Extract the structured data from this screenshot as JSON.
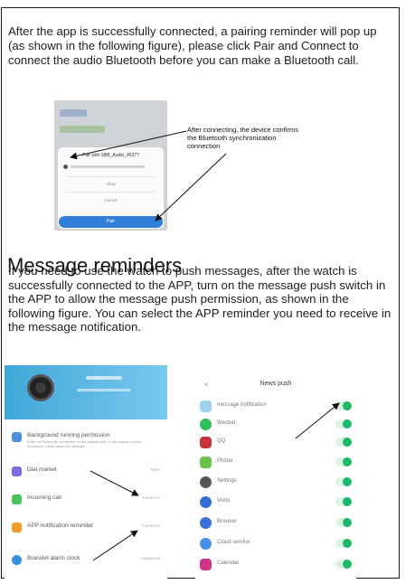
{
  "intro": {
    "text": "After the app is successfully connected, a pairing reminder will pop up (as shown in the following figure), please click Pair and Connect to connect the audio Bluetooth before you can make a Bluetooth call."
  },
  "pairing_dialog": {
    "title": "Pair with SBB_Audio_4637?",
    "option_1": "Allow",
    "option_2": "Cancel",
    "button": "Pair",
    "annotation": "After connecting, the device confirms the Bluetooth synchronization connection"
  },
  "section": {
    "heading": "Message reminders",
    "text": "If you need to use the watch to push messages, after the watch is successfully connected to the APP, turn on the message push switch in the APP to allow the message push permission, as shown in the following figure. You can select the APP reminder you need to receive in the message notification."
  },
  "app_left": {
    "rows": [
      {
        "label": "Background running permission",
        "sub": "Keep the Bluetooth connection in the background; in permission ensure reminders. Learn about the settings",
        "value": "",
        "color": "#4a90d9"
      },
      {
        "label": "Dial market",
        "sub": "",
        "value": "More",
        "color": "#7b6ae0"
      },
      {
        "label": "Incoming call",
        "sub": "",
        "value": "Turned on",
        "color": "#4cc25a"
      },
      {
        "label": "APP notification reminder",
        "sub": "",
        "value": "Turned on",
        "color": "#f09a2c"
      },
      {
        "label": "Bracelet alarm clock",
        "sub": "",
        "value": "Unopened",
        "color": "#3a8ee0"
      }
    ]
  },
  "app_right": {
    "back": "<",
    "title": "News push",
    "rows": [
      {
        "label": "message notification",
        "color": "#9fd0f0"
      },
      {
        "label": "Wechat",
        "color": "#2fbf5a"
      },
      {
        "label": "QQ",
        "color": "#c7343a"
      },
      {
        "label": "Phone",
        "color": "#6cc24a"
      },
      {
        "label": "Settings",
        "color": "#555555"
      },
      {
        "label": "Visits",
        "color": "#2f6fd6"
      },
      {
        "label": "Browser",
        "color": "#3b6fd8"
      },
      {
        "label": "Cloud service",
        "color": "#4a8ee8"
      },
      {
        "label": "Calendar",
        "color": "#d1348a"
      }
    ]
  }
}
